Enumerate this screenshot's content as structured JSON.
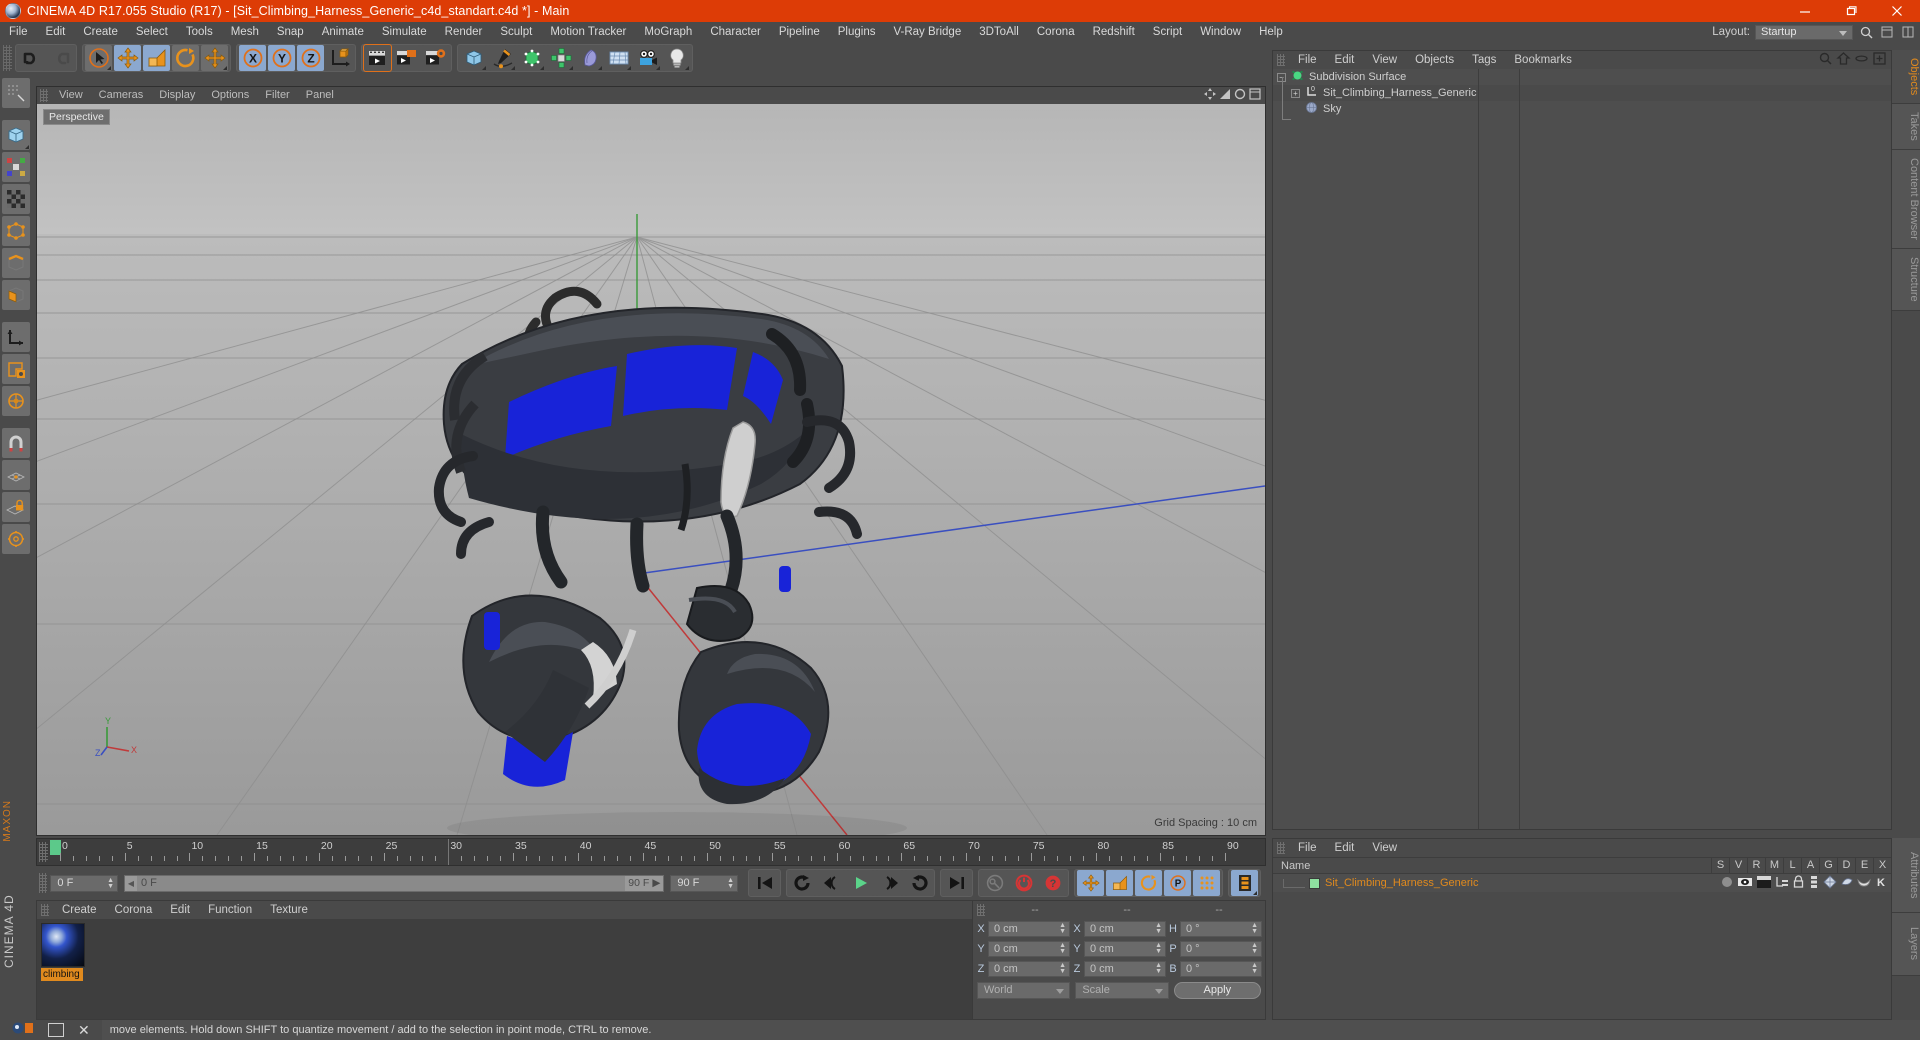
{
  "window": {
    "title": "CINEMA 4D R17.055 Studio (R17) - [Sit_Climbing_Harness_Generic_c4d_standart.c4d *] - Main",
    "minimize": "—",
    "restore": "❐",
    "close": "✕",
    "accent_color": "#dd3c06",
    "chrome_color": "#4a4a4a"
  },
  "menubar": {
    "items": [
      "File",
      "Edit",
      "Create",
      "Select",
      "Tools",
      "Mesh",
      "Snap",
      "Animate",
      "Simulate",
      "Render",
      "Sculpt",
      "Motion Tracker",
      "MoGraph",
      "Character",
      "Pipeline",
      "Plugins",
      "V-Ray Bridge",
      "3DToAll",
      "Corona",
      "Redshift",
      "Script",
      "Window",
      "Help"
    ],
    "layout_label": "Layout:",
    "layout_value": "Startup"
  },
  "toolbar": {
    "groups": [
      {
        "name": "history",
        "buttons": [
          {
            "name": "undo-button",
            "icon": "undo-icon",
            "state": "normal"
          },
          {
            "name": "redo-button",
            "icon": "redo-icon",
            "state": "disabled"
          }
        ]
      },
      {
        "name": "transform",
        "buttons": [
          {
            "name": "live-selection-tool",
            "icon": "cursor-circle-icon",
            "state": "normal"
          },
          {
            "name": "move-tool",
            "icon": "move-arrows-icon",
            "state": "active"
          },
          {
            "name": "scale-tool",
            "icon": "scale-box-icon",
            "state": "normal"
          },
          {
            "name": "rotate-tool",
            "icon": "rotate-circle-icon",
            "state": "normal"
          },
          {
            "name": "drag-tool",
            "icon": "move-arrows-icon",
            "state": "normal"
          }
        ]
      },
      {
        "name": "axis-locks",
        "buttons": [
          {
            "name": "x-axis-lock",
            "icon": "x-axis-icon",
            "state": "active"
          },
          {
            "name": "y-axis-lock",
            "icon": "y-axis-icon",
            "state": "active"
          },
          {
            "name": "z-axis-lock",
            "icon": "z-axis-icon",
            "state": "active"
          },
          {
            "name": "world-object-coords",
            "icon": "world-axis-cube-icon",
            "state": "normal"
          }
        ]
      },
      {
        "name": "render",
        "buttons": [
          {
            "name": "render-view-button",
            "icon": "render-clapper-icon",
            "state": "normal"
          },
          {
            "name": "render-to-picture-viewer-button",
            "icon": "render-picture-icon",
            "state": "normal"
          },
          {
            "name": "render-settings-button",
            "icon": "render-settings-icon",
            "state": "normal"
          }
        ]
      },
      {
        "name": "objects",
        "buttons": [
          {
            "name": "add-cube-button",
            "icon": "cube-icon",
            "state": "normal"
          },
          {
            "name": "add-spline-button",
            "icon": "pen-spline-icon",
            "state": "normal"
          },
          {
            "name": "add-generator-button",
            "icon": "generator-icon",
            "state": "normal"
          },
          {
            "name": "add-modeling-object-button",
            "icon": "array-icon",
            "state": "normal"
          },
          {
            "name": "add-deformer-button",
            "icon": "bend-deformer-icon",
            "state": "normal"
          },
          {
            "name": "add-environment-button",
            "icon": "floor-grid-icon",
            "state": "normal"
          },
          {
            "name": "add-camera-button",
            "icon": "camera-icon",
            "state": "normal"
          },
          {
            "name": "add-light-button",
            "icon": "light-bulb-icon",
            "state": "normal"
          }
        ]
      }
    ]
  },
  "left_palette": {
    "items": [
      {
        "name": "texture-axis-tool",
        "icon": "texture-axis-icon"
      },
      {
        "name": "model-mode",
        "icon": "model-cube-icon"
      },
      {
        "name": "object-axis-mode",
        "icon": "object-axis-icon"
      },
      {
        "name": "texture-mode",
        "icon": "texture-mode-icon"
      },
      {
        "name": "points-mode",
        "icon": "points-icon"
      },
      {
        "name": "edges-mode",
        "icon": "edges-icon"
      },
      {
        "name": "polygons-mode",
        "icon": "polygons-icon"
      },
      {
        "name": "enable-axis-modification",
        "icon": "axis-modify-icon"
      },
      {
        "name": "viewport-solo-single",
        "icon": "solo-single-icon"
      },
      {
        "name": "viewport-solo-hierarchy",
        "icon": "solo-hierarchy-icon"
      },
      {
        "name": "enable-snapping",
        "icon": "magnet-icon"
      },
      {
        "name": "workplane-mode",
        "icon": "workplane-icon"
      },
      {
        "name": "lock-workplane",
        "icon": "lock-workplane-icon"
      },
      {
        "name": "workplane-settings",
        "icon": "workplane-settings-icon"
      }
    ],
    "branding": "CINEMA 4D",
    "branding_top": "MAXON"
  },
  "viewport": {
    "menu": [
      "View",
      "Cameras",
      "Display",
      "Options",
      "Filter",
      "Panel"
    ],
    "label": "Perspective",
    "grid_spacing": "Grid Spacing : 10 cm",
    "axis_gizmo": {
      "x": "X",
      "y": "Y",
      "z": "Z"
    },
    "panel_icons": [
      "viewport-move-icon",
      "viewport-scale-icon",
      "viewport-rotate-icon",
      "viewport-maximize-icon"
    ]
  },
  "timeline": {
    "ticks": [
      {
        "label": "0",
        "value": 0
      },
      {
        "label": "5",
        "value": 5
      },
      {
        "label": "10",
        "value": 10
      },
      {
        "label": "15",
        "value": 15
      },
      {
        "label": "20",
        "value": 20
      },
      {
        "label": "25",
        "value": 25
      },
      {
        "label": "30",
        "value": 30
      },
      {
        "label": "35",
        "value": 35
      },
      {
        "label": "40",
        "value": 40
      },
      {
        "label": "45",
        "value": 45
      },
      {
        "label": "50",
        "value": 50
      },
      {
        "label": "55",
        "value": 55
      },
      {
        "label": "60",
        "value": 60
      },
      {
        "label": "65",
        "value": 65
      },
      {
        "label": "70",
        "value": 70
      },
      {
        "label": "75",
        "value": 75
      },
      {
        "label": "80",
        "value": 80
      },
      {
        "label": "85",
        "value": 85
      },
      {
        "label": "90",
        "value": 90
      }
    ],
    "current_frame_marker": "0",
    "end_readout": "0 F"
  },
  "transport": {
    "current_frame": "0 F",
    "range_start": "0 F",
    "range_end": "90 F",
    "max_frame": "90 F",
    "buttons": [
      {
        "name": "go-to-start-button",
        "icon": "skip-start-icon"
      },
      {
        "name": "play-backwards-button",
        "icon": "rewind-loop-icon"
      },
      {
        "name": "previous-frame-button",
        "icon": "step-back-icon"
      },
      {
        "name": "play-button",
        "icon": "play-icon"
      },
      {
        "name": "next-frame-button",
        "icon": "step-forward-icon"
      },
      {
        "name": "play-forwards-button",
        "icon": "forward-loop-icon"
      },
      {
        "name": "go-to-end-button",
        "icon": "skip-end-icon"
      },
      {
        "name": "record-active-objects-button",
        "icon": "key-icon"
      },
      {
        "name": "autokeying-button",
        "icon": "autokey-icon"
      },
      {
        "name": "keyframe-selection-button",
        "icon": "question-key-icon"
      },
      {
        "name": "position-key-button",
        "icon": "position-key-icon"
      },
      {
        "name": "scale-key-button",
        "icon": "scale-key-icon"
      },
      {
        "name": "rotation-key-button",
        "icon": "rotation-key-icon"
      },
      {
        "name": "parameter-key-button",
        "icon": "parameter-key-icon"
      },
      {
        "name": "point-level-animation-button",
        "icon": "pla-icon"
      },
      {
        "name": "timeline-toggle-button",
        "icon": "filmstrip-icon"
      }
    ]
  },
  "material_manager": {
    "menu": [
      "Create",
      "Corona",
      "Edit",
      "Function",
      "Texture"
    ],
    "materials": [
      {
        "name": "climbing",
        "selected": true
      }
    ]
  },
  "coordinate_manager": {
    "header": [
      "--",
      "--",
      "--"
    ],
    "rows": [
      {
        "pos_label": "X",
        "pos_value": "0 cm",
        "size_label": "X",
        "size_value": "0 cm",
        "rot_label": "H",
        "rot_value": "0 °"
      },
      {
        "pos_label": "Y",
        "pos_value": "0 cm",
        "size_label": "Y",
        "size_value": "0 cm",
        "rot_label": "P",
        "rot_value": "0 °"
      },
      {
        "pos_label": "Z",
        "pos_value": "0 cm",
        "size_label": "Z",
        "size_value": "0 cm",
        "rot_label": "B",
        "rot_value": "0 °"
      }
    ],
    "coord_system": "World",
    "mode": "Scale",
    "apply_label": "Apply"
  },
  "object_manager": {
    "menu": [
      "File",
      "Edit",
      "View",
      "Objects",
      "Tags",
      "Bookmarks"
    ],
    "header_icons": [
      "search-icon",
      "home-icon",
      "ellipse-icon",
      "add-layer-icon"
    ],
    "objects": [
      {
        "name": "Subdivision Surface",
        "icon": "subdivision-surface-icon",
        "depth": 0,
        "expandable": true,
        "tag": "checker",
        "dot": "check-green"
      },
      {
        "name": "Sit_Climbing_Harness_Generic",
        "icon": "null-object-icon",
        "depth": 1,
        "expandable": true,
        "tag": "green",
        "dot": "none"
      },
      {
        "name": "Sky",
        "icon": "sky-icon",
        "depth": 1,
        "expandable": false,
        "tag": "checker",
        "dot": "red"
      }
    ],
    "side_tabs": [
      "Objects",
      "Takes",
      "Content Browser",
      "Structure"
    ],
    "side_tabs_bottom": [
      "Attributes",
      "Layers"
    ]
  },
  "tag_manager": {
    "menu": [
      "File",
      "Edit",
      "View"
    ],
    "columns": [
      "Name",
      "S",
      "V",
      "R",
      "M",
      "L",
      "A",
      "G",
      "D",
      "E",
      "X"
    ],
    "rows": [
      {
        "name": "Sit_Climbing_Harness_Generic",
        "icons": [
          "solo-dot-icon",
          "visibility-icon",
          "render-icon",
          "layer-icon",
          "lock-icon",
          "align-icon",
          "generator-icon",
          "deformer-icon",
          "dynamics-icon",
          "expression-icon"
        ]
      }
    ]
  },
  "statusbar": {
    "message": "move elements. Hold down SHIFT to quantize movement / add to the selection in point mode, CTRL to remove.",
    "taskbar_icons": [
      "c4d-taskbar-icon",
      "window-icon",
      "close-icon"
    ]
  }
}
